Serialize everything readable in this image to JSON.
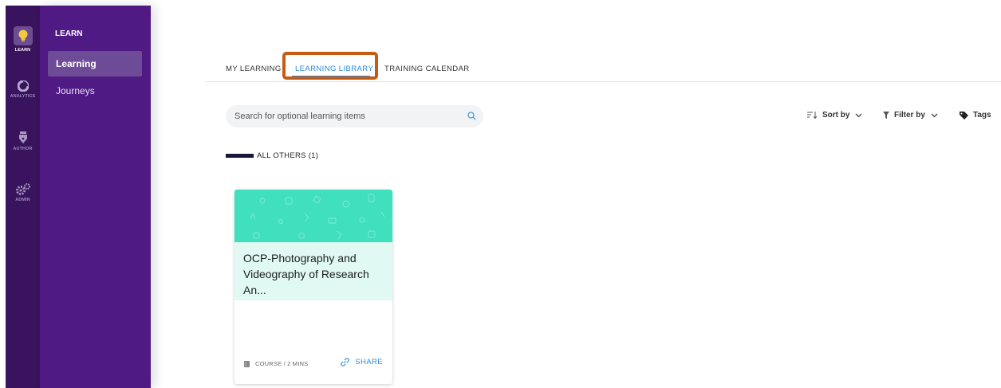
{
  "rail": {
    "items": [
      {
        "label": "LEARN",
        "icon": "lightbulb-icon"
      },
      {
        "label": "ANALYTICS",
        "icon": "pie-chart-icon"
      },
      {
        "label": "AUTHOR",
        "icon": "pen-nib-icon"
      },
      {
        "label": "ADMIN",
        "icon": "gears-icon"
      }
    ]
  },
  "nav": {
    "title": "LEARN",
    "items": [
      {
        "label": "Learning"
      },
      {
        "label": "Journeys"
      }
    ]
  },
  "tabs": [
    {
      "label": "MY LEARNING"
    },
    {
      "label": "LEARNING LIBRARY"
    },
    {
      "label": "TRAINING CALENDAR"
    }
  ],
  "search": {
    "placeholder": "Search for optional learning items"
  },
  "toolbar": {
    "sort_label": "Sort by",
    "filter_label": "Filter by",
    "tags_label": "Tags"
  },
  "section": {
    "title": "ALL OTHERS (1)"
  },
  "card": {
    "title": "OCP-Photography and Videography of Research An...",
    "meta": "COURSE / 2 MINS",
    "share_label": "SHARE"
  },
  "colors": {
    "rail": "#3a135e",
    "nav": "#4f1a84",
    "accent": "#2b8ad9",
    "highlight": "#c65c14",
    "card_banner": "#40dfbe",
    "card_title_bg": "#e0f9f3"
  }
}
